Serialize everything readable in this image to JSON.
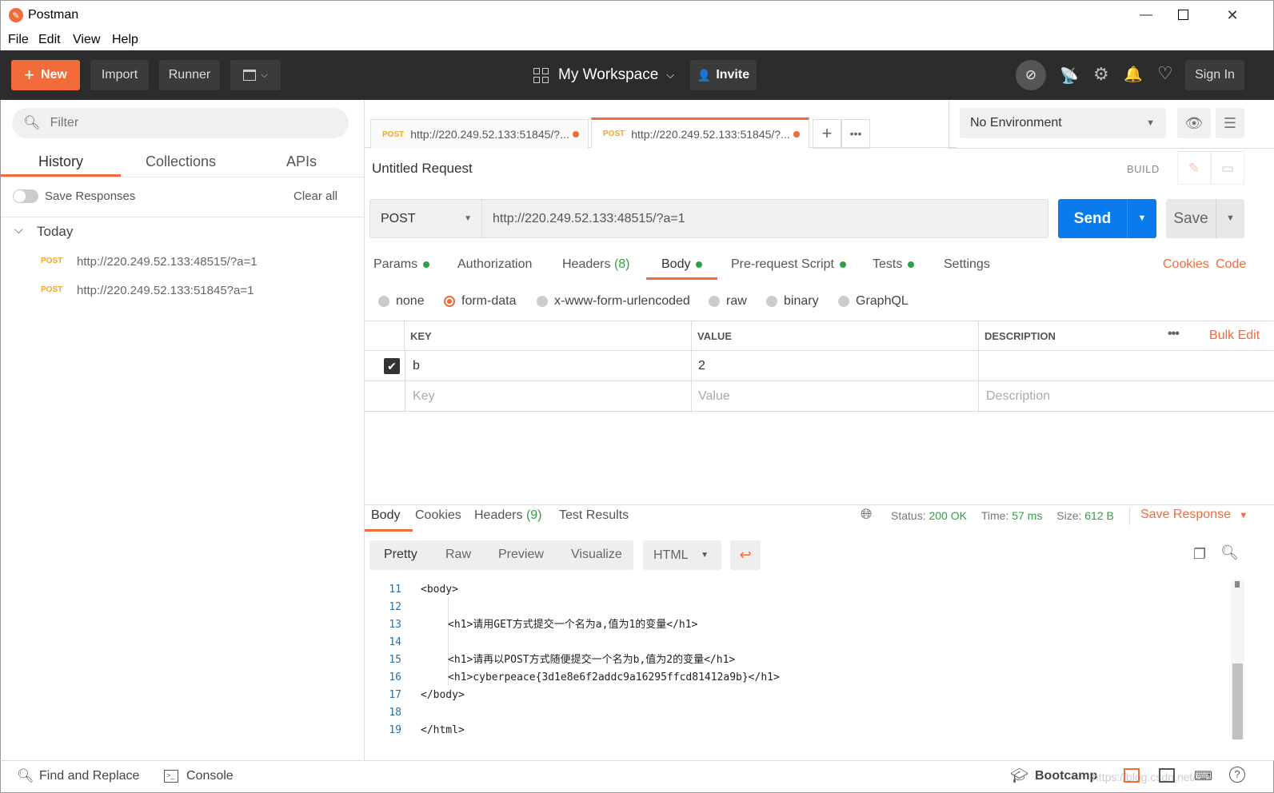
{
  "window": {
    "title": "Postman",
    "min": "—",
    "max": "☐",
    "close": "✕"
  },
  "menu": [
    "File",
    "Edit",
    "View",
    "Help"
  ],
  "toolbar": {
    "new_label": "New",
    "import_label": "Import",
    "runner_label": "Runner",
    "workspace_label": "My Workspace",
    "invite_label": "Invite",
    "signin_label": "Sign In"
  },
  "sidebar": {
    "filter_placeholder": "Filter",
    "tabs": [
      "History",
      "Collections",
      "APIs"
    ],
    "save_responses": "Save Responses",
    "clear_all": "Clear all",
    "group": "Today",
    "items": [
      {
        "method": "POST",
        "url": "http://220.249.52.133:48515/?a=1"
      },
      {
        "method": "POST",
        "url": "http://220.249.52.133:51845?a=1"
      }
    ]
  },
  "tabs": [
    {
      "method": "POST",
      "url": "http://220.249.52.133:51845/?..."
    },
    {
      "method": "POST",
      "url": "http://220.249.52.133:51845/?..."
    }
  ],
  "environment": "No Environment",
  "request": {
    "title": "Untitled Request",
    "build": "BUILD",
    "method": "POST",
    "url": "http://220.249.52.133:48515/?a=1",
    "send": "Send",
    "save": "Save"
  },
  "req_tabs": {
    "params": "Params",
    "authorization": "Authorization",
    "headers": "Headers",
    "headers_count": "(8)",
    "body": "Body",
    "prerequest": "Pre-request Script",
    "tests": "Tests",
    "settings": "Settings",
    "cookies": "Cookies",
    "code": "Code"
  },
  "body_types": [
    "none",
    "form-data",
    "x-www-form-urlencoded",
    "raw",
    "binary",
    "GraphQL"
  ],
  "form_table": {
    "headers": [
      "KEY",
      "VALUE",
      "DESCRIPTION"
    ],
    "bulk_edit": "Bulk Edit",
    "rows": [
      {
        "key": "b",
        "value": "2",
        "description": ""
      }
    ],
    "placeholder": {
      "key": "Key",
      "value": "Value",
      "description": "Description"
    }
  },
  "response": {
    "tabs": {
      "body": "Body",
      "cookies": "Cookies",
      "headers": "Headers",
      "headers_count": "(9)",
      "tests": "Test Results"
    },
    "status_label": "Status:",
    "status": "200 OK",
    "time_label": "Time:",
    "time": "57 ms",
    "size_label": "Size:",
    "size": "612 B",
    "save_response": "Save Response",
    "views": [
      "Pretty",
      "Raw",
      "Preview",
      "Visualize"
    ],
    "format": "HTML"
  },
  "code_lines": [
    {
      "n": "11",
      "indent": 0,
      "text": "<body>"
    },
    {
      "n": "12",
      "indent": 1,
      "text": ""
    },
    {
      "n": "13",
      "indent": 1,
      "text": "<h1>请用GET方式提交一个名为a,值为1的变量</h1>"
    },
    {
      "n": "14",
      "indent": 1,
      "text": ""
    },
    {
      "n": "15",
      "indent": 1,
      "text": "<h1>请再以POST方式随便提交一个名为b,值为2的变量</h1>"
    },
    {
      "n": "16",
      "indent": 1,
      "text": "<h1>cyberpeace{3d1e8e6f2addc9a16295ffcd81412a9b}</h1>"
    },
    {
      "n": "17",
      "indent": 0,
      "text": "</body>"
    },
    {
      "n": "18",
      "indent": 0,
      "text": ""
    },
    {
      "n": "19",
      "indent": 0,
      "text": "</html>"
    }
  ],
  "statusbar": {
    "find": "Find and Replace",
    "console": "Console",
    "bootcamp": "Bootcamp",
    "watermark": "https://blog.csdn.net/..."
  },
  "colors": {
    "accent": "#f26b3a",
    "send": "#097bed",
    "toolbar": "#2c2c2c",
    "green": "#2ea043"
  }
}
